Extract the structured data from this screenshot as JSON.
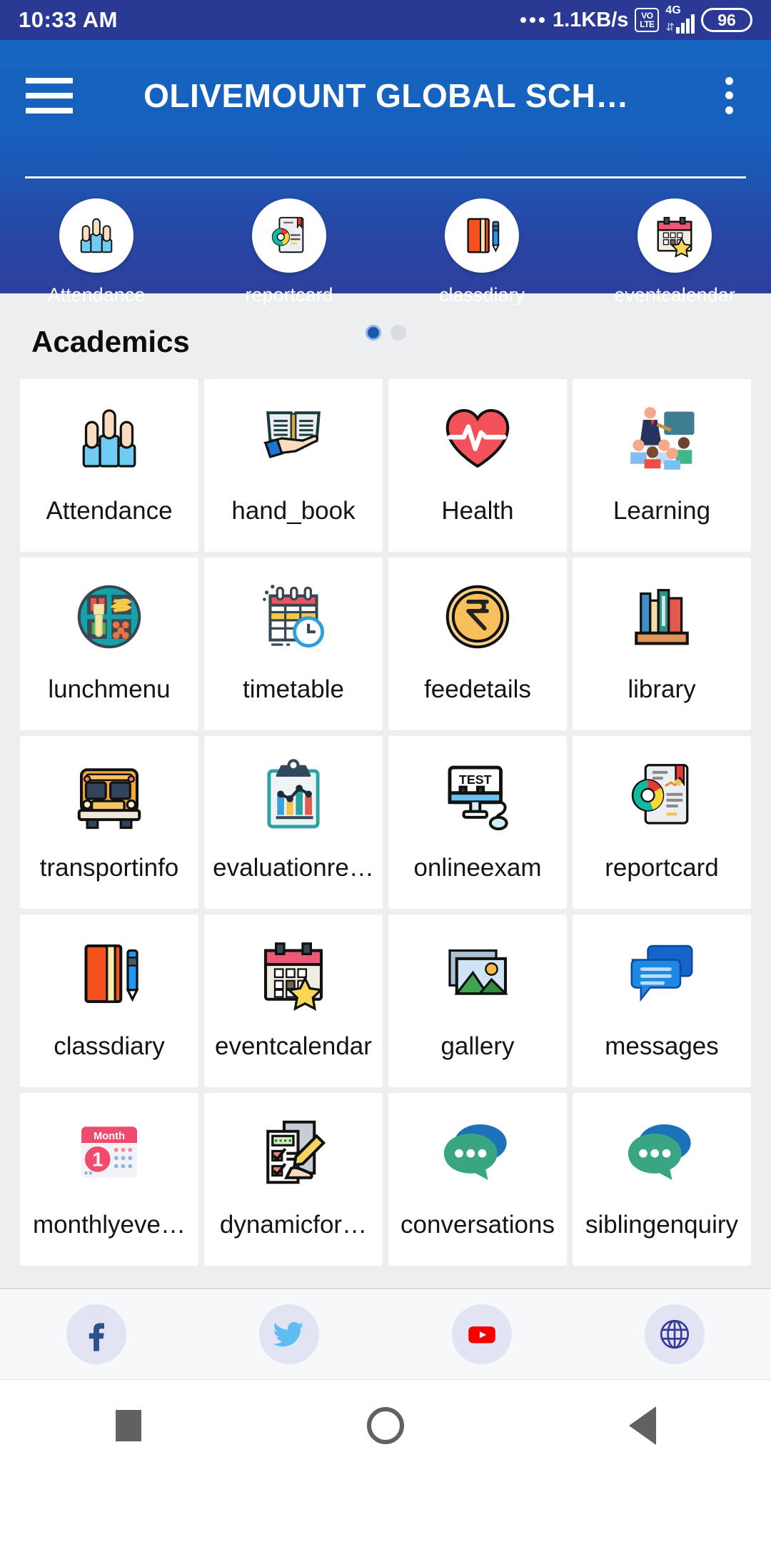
{
  "statusbar": {
    "time": "10:33 AM",
    "network_speed": "1.1KB/s",
    "volte_top": "VO",
    "volte_bottom": "LTE",
    "network_type": "4G",
    "battery": "96"
  },
  "header": {
    "title": "OLIVEMOUNT GLOBAL SCH…",
    "menu_icon": "hamburger-icon",
    "overflow_icon": "kebab-icon"
  },
  "quick_access": {
    "items": [
      {
        "label": "Attendance",
        "icon": "raised-hands-icon"
      },
      {
        "label": "reportcard",
        "icon": "report-document-icon"
      },
      {
        "label": "classdiary",
        "icon": "diary-pen-icon"
      },
      {
        "label": "eventcalendar",
        "icon": "calendar-star-icon"
      }
    ],
    "pager": {
      "total": 2,
      "active": 1
    }
  },
  "main": {
    "section_title": "Academics",
    "tiles": [
      {
        "label": "Attendance",
        "icon": "raised-hands-icon"
      },
      {
        "label": "hand_book",
        "icon": "handbook-icon"
      },
      {
        "label": "Health",
        "icon": "heart-pulse-icon"
      },
      {
        "label": "Learning",
        "icon": "classroom-teacher-icon"
      },
      {
        "label": "lunchmenu",
        "icon": "food-tray-icon"
      },
      {
        "label": "timetable",
        "icon": "calendar-clock-icon"
      },
      {
        "label": "feedetails",
        "icon": "rupee-coin-icon"
      },
      {
        "label": "library",
        "icon": "books-shelf-icon"
      },
      {
        "label": "transportinfo",
        "icon": "school-bus-icon"
      },
      {
        "label": "evaluationre…",
        "icon": "clipboard-chart-icon"
      },
      {
        "label": "onlineexam",
        "icon": "monitor-test-icon"
      },
      {
        "label": "reportcard",
        "icon": "report-document-icon"
      },
      {
        "label": "classdiary",
        "icon": "diary-pen-icon"
      },
      {
        "label": "eventcalendar",
        "icon": "calendar-star-icon"
      },
      {
        "label": "gallery",
        "icon": "photos-icon"
      },
      {
        "label": "messages",
        "icon": "chat-bubbles-icon"
      },
      {
        "label": "monthlyeve…",
        "icon": "month-calendar-icon"
      },
      {
        "label": "dynamicfor…",
        "icon": "form-pencil-icon"
      },
      {
        "label": "conversations",
        "icon": "speech-bubbles-icon"
      },
      {
        "label": "siblingenquiry",
        "icon": "speech-bubbles-icon"
      }
    ]
  },
  "social": {
    "items": [
      {
        "name": "facebook",
        "icon": "facebook-icon"
      },
      {
        "name": "twitter",
        "icon": "twitter-icon"
      },
      {
        "name": "youtube",
        "icon": "youtube-icon"
      },
      {
        "name": "website",
        "icon": "globe-icon"
      }
    ]
  },
  "navbar": {
    "items": [
      {
        "name": "recents",
        "icon": "square-icon"
      },
      {
        "name": "home",
        "icon": "circle-icon"
      },
      {
        "name": "back",
        "icon": "triangle-back-icon"
      }
    ]
  },
  "colors": {
    "status_bar": "#2a3a94",
    "header_top": "#1565c0",
    "header_bottom": "#2d3f9b",
    "body_bg": "#eceef0",
    "tile_bg": "#ffffff"
  }
}
